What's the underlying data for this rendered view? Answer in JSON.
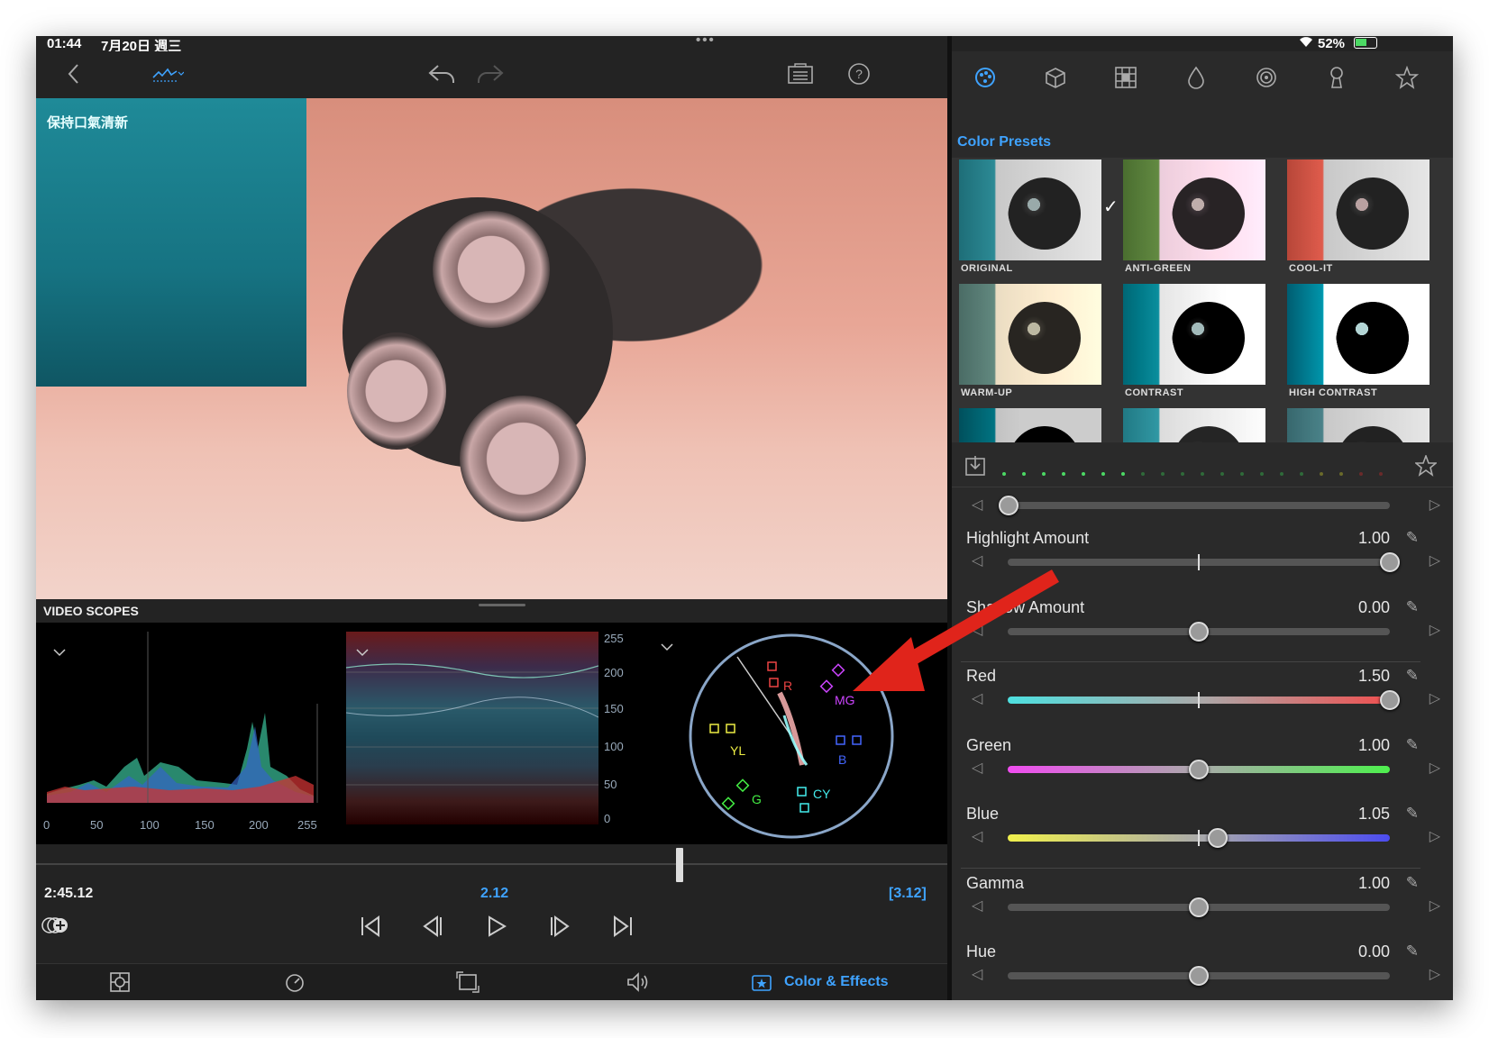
{
  "status": {
    "time": "01:44",
    "date": "7月20日 週三",
    "battery": "52%"
  },
  "toolbar": {
    "back_icon": "chevron-left-icon",
    "scopes_icon": "waveform-icon",
    "undo_icon": "undo-icon",
    "redo_icon": "redo-icon",
    "notes_icon": "clipboard-icon",
    "help_icon": "help-icon"
  },
  "viewer": {
    "label_text": "保持口氣清新"
  },
  "scopes": {
    "title": "VIDEO SCOPES",
    "histogram_ticks": [
      "0",
      "50",
      "100",
      "150",
      "200",
      "255"
    ],
    "waveform_ticks": [
      "255",
      "200",
      "150",
      "100",
      "50",
      "0"
    ],
    "vectorscope_labels": {
      "r": "R",
      "mg": "MG",
      "b": "B",
      "cy": "CY",
      "g": "G",
      "yl": "YL"
    }
  },
  "transport": {
    "current_time": "2:45.12",
    "center_value": "2.12",
    "right_value": "[3.12]"
  },
  "bottombar": {
    "color_effects_label": "Color & Effects"
  },
  "right_panel": {
    "tabs": [
      "palette-icon",
      "cube-icon",
      "grid-icon",
      "drop-icon",
      "spiral-icon",
      "keyhole-icon",
      "star-icon"
    ],
    "section_title": "Color Presets",
    "presets": [
      {
        "name": "ORIGINAL",
        "selected": true
      },
      {
        "name": "ANTI-GREEN"
      },
      {
        "name": "COOL-IT"
      },
      {
        "name": "WARM-UP"
      },
      {
        "name": "CONTRAST"
      },
      {
        "name": "HIGH CONTRAST"
      }
    ],
    "params": [
      {
        "label": "Highlight Amount",
        "value": "1.00",
        "position": 1.0
      },
      {
        "label": "Shadow Amount",
        "value": "0.00",
        "position": 0.5
      },
      {
        "label": "Red",
        "value": "1.50",
        "position": 1.0
      },
      {
        "label": "Green",
        "value": "1.00",
        "position": 0.5
      },
      {
        "label": "Blue",
        "value": "1.05",
        "position": 0.55
      },
      {
        "label": "Gamma",
        "value": "1.00",
        "position": 0.5
      },
      {
        "label": "Hue",
        "value": "0.00",
        "position": 0.5
      }
    ]
  },
  "colors": {
    "accent": "#3fa3ff",
    "annotation_arrow": "#e0241b"
  }
}
